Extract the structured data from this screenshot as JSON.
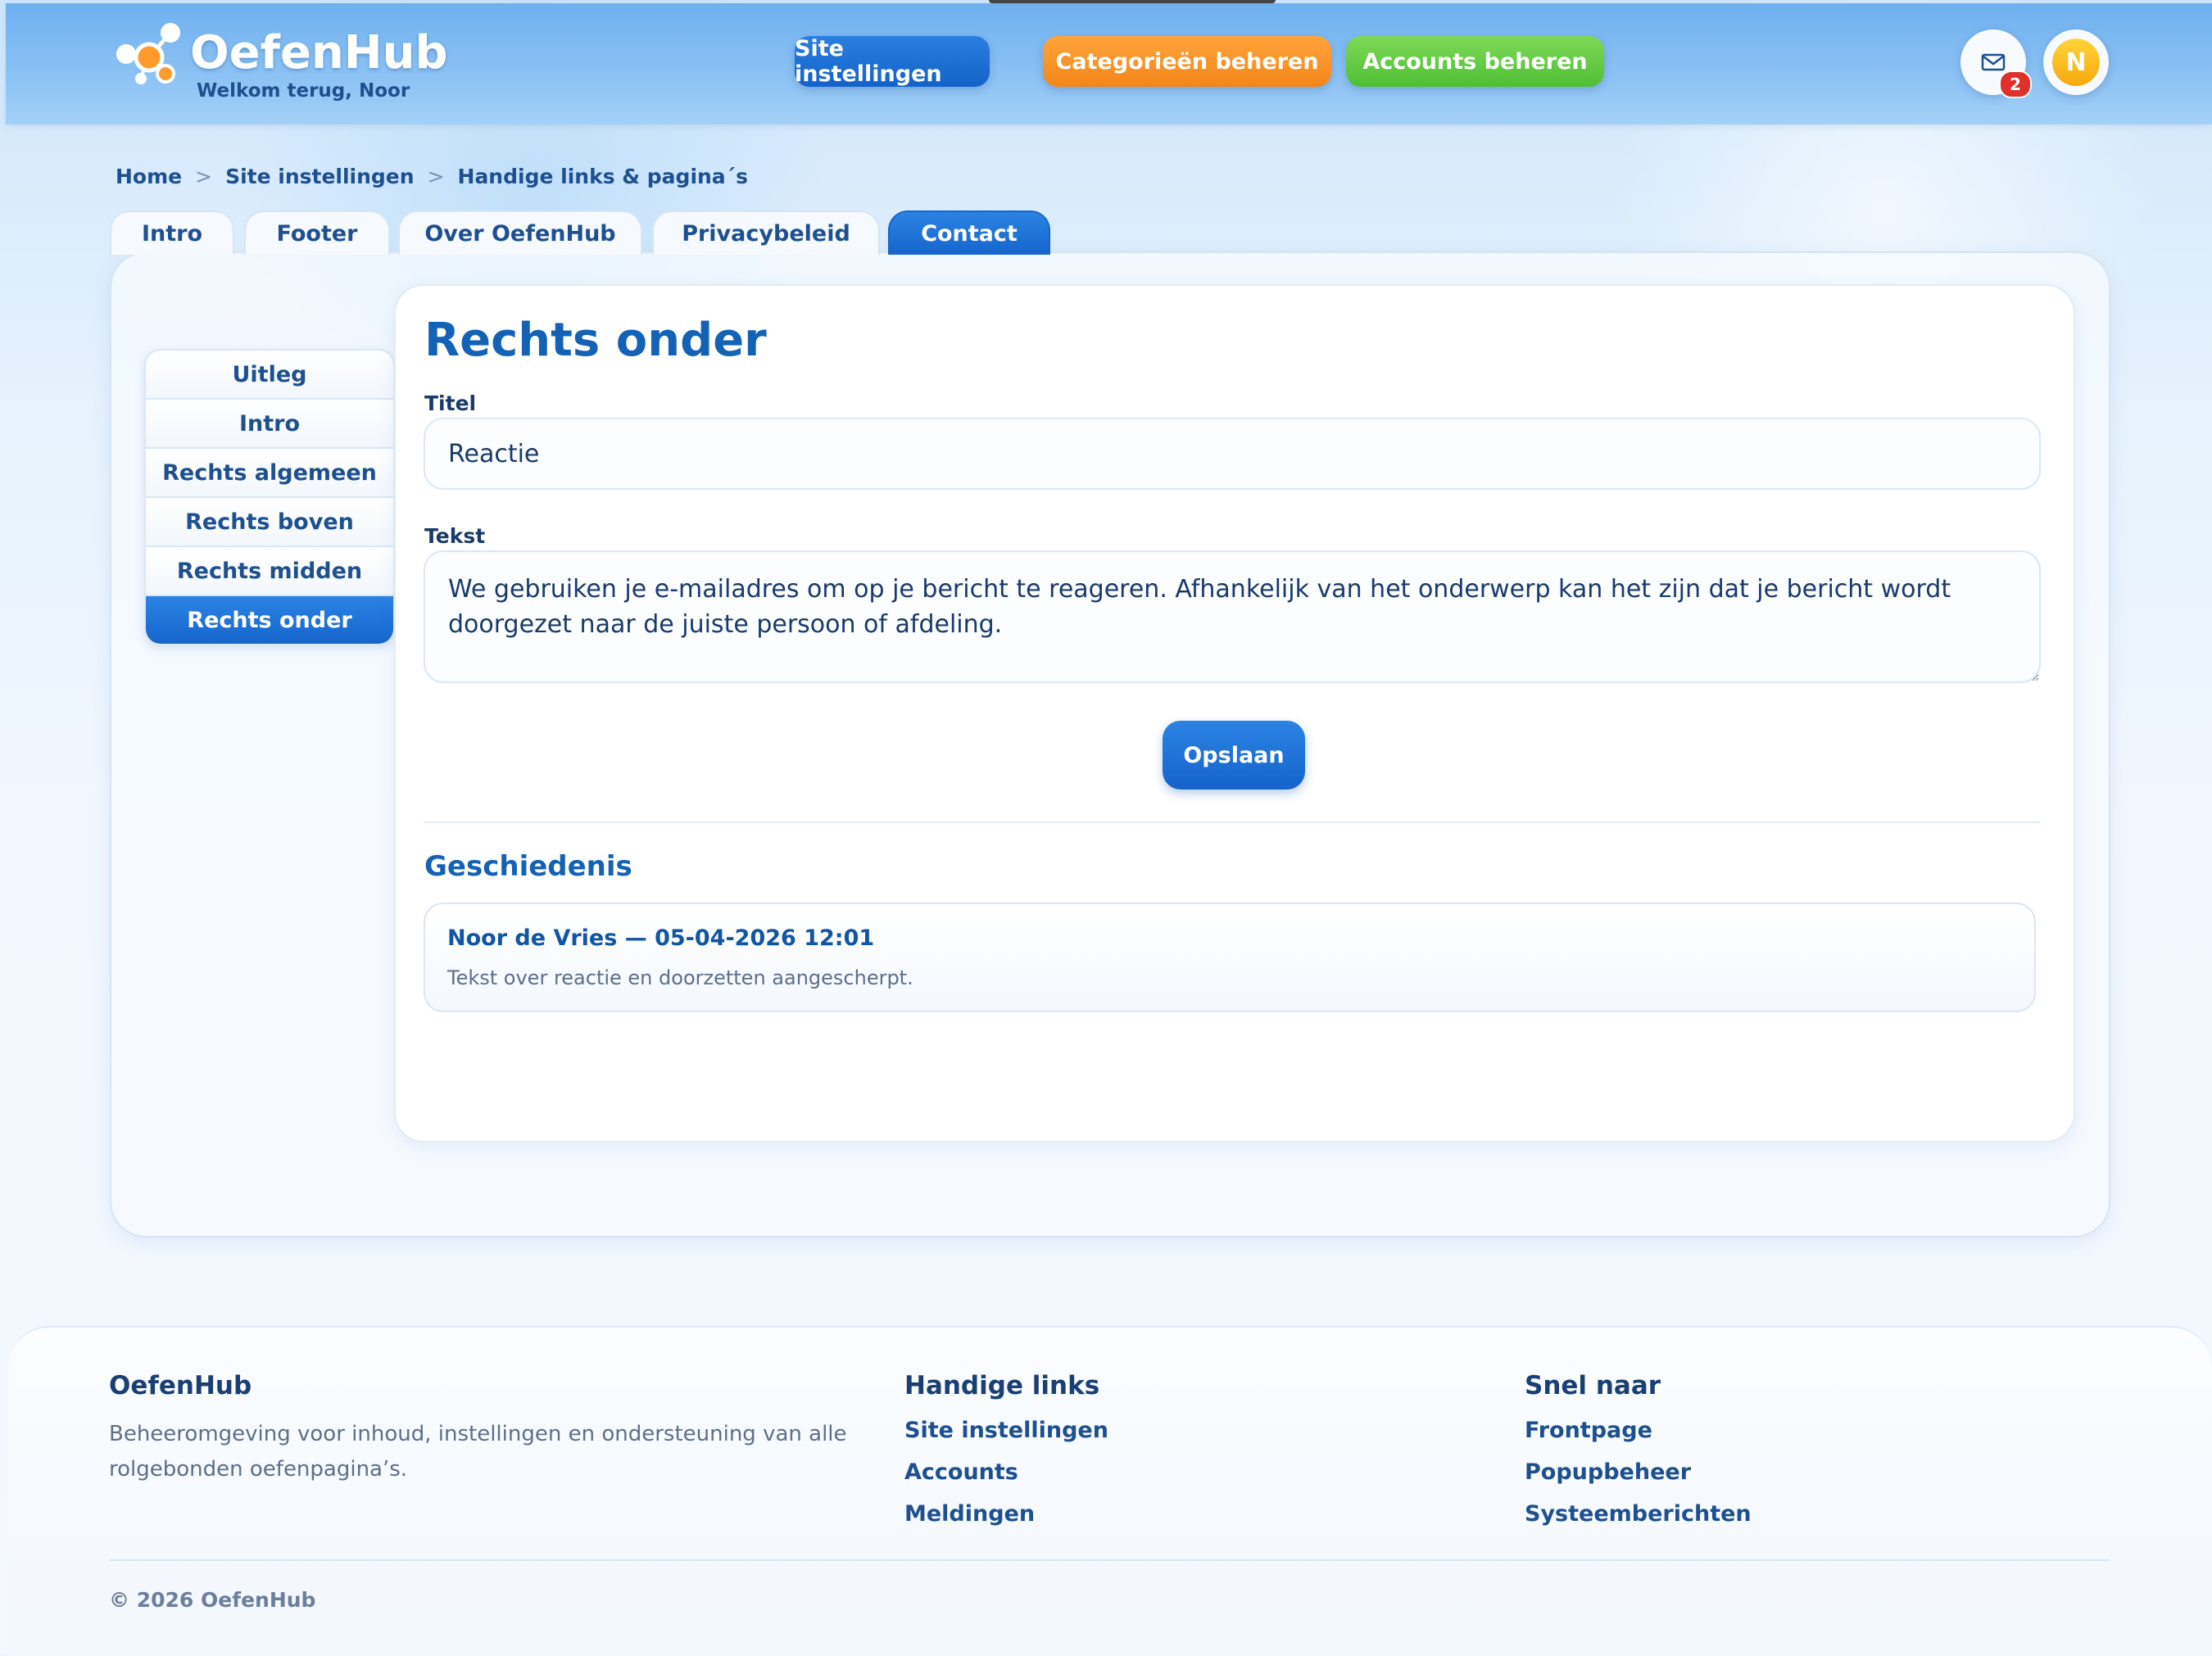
{
  "header": {
    "logo_name": "OefenHub",
    "welcome": "Welkom terug, Noor",
    "nav": {
      "site_settings": "Site instellingen",
      "categories": "Categorieën beheren",
      "accounts": "Accounts beheren"
    },
    "mail_badge_count": "2",
    "avatar_initial": "N",
    "colors": {
      "site_settings": "#1a6fd6",
      "categories": "#f78f22",
      "accounts": "#62cc45"
    }
  },
  "breadcrumb": {
    "home": "Home",
    "site_settings": "Site instellingen",
    "current": "Handige links & pagina´s",
    "separator": ">"
  },
  "tabs": [
    "Intro",
    "Footer",
    "Over OefenHub",
    "Privacybeleid",
    "Contact"
  ],
  "active_tab": "Contact",
  "side_nav": {
    "items": [
      "Uitleg",
      "Intro",
      "Rechts algemeen",
      "Rechts boven",
      "Rechts midden",
      "Rechts onder"
    ],
    "active": "Rechts onder"
  },
  "editor": {
    "title": "Rechts onder",
    "titel_label": "Titel",
    "titel_value": "Reactie",
    "tekst_label": "Tekst",
    "tekst_value": "We gebruiken je e-mailadres om op je bericht te reageren. Afhankelijk van het onderwerp kan het zijn dat je bericht wordt doorgezet naar de juiste persoon of afdeling.",
    "save_label": "Opslaan"
  },
  "history": {
    "title": "Geschiedenis",
    "entries": [
      {
        "author_date": "Noor de Vries — 05-04-2026 12:01",
        "note": "Tekst over reactie en doorzetten aangescherpt."
      }
    ]
  },
  "footer": {
    "brand_title": "OefenHub",
    "description": "Beheeromgeving voor inhoud, instellingen en ondersteuning van alle rolgebonden oefenpagina’s.",
    "links_title": "Handige links",
    "links": [
      "Site instellingen",
      "Accounts",
      "Meldingen"
    ],
    "quick_title": "Snel naar",
    "quick": [
      "Frontpage",
      "Popupbeheer",
      "Systeemberichten"
    ],
    "copyright": "© 2026 OefenHub"
  },
  "icons": {
    "mail": "mail-icon",
    "logo": "molecule-logo-icon"
  }
}
